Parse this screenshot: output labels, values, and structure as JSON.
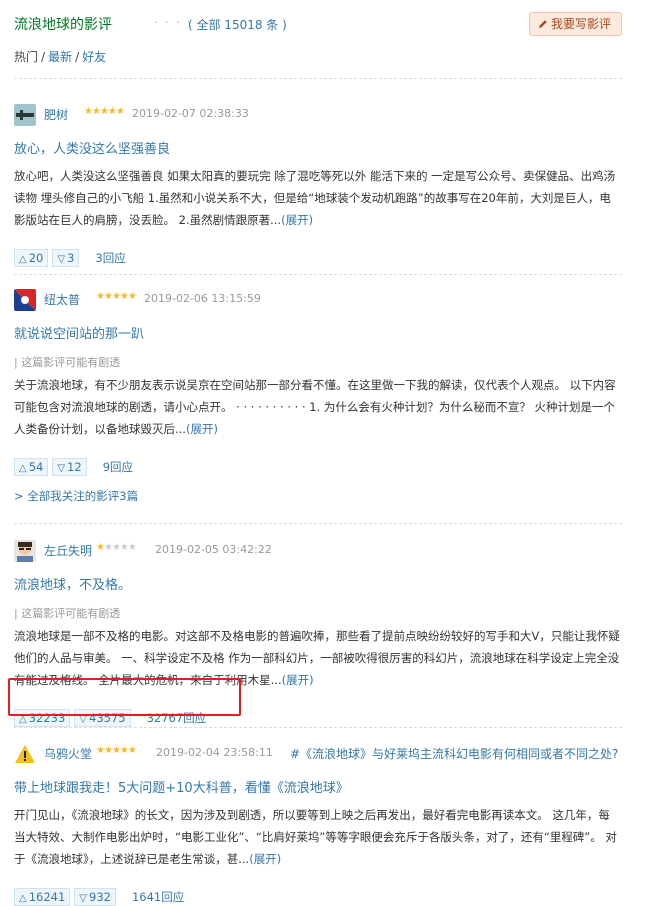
{
  "header": {
    "title": "流浪地球的影评",
    "dots": "· · · · · ·",
    "total": "( 全部 15018 条 )",
    "write_button": "我要写影评"
  },
  "filters": {
    "hot": "热门",
    "sep1": "/",
    "latest": "最新",
    "sep2": "/",
    "friends": "好友"
  },
  "reviews": [
    {
      "author": "肥树",
      "stars": 5,
      "date": "2019-02-07 02:38:33",
      "title": "放心，人类没这么坚强善良",
      "body": "放心吧，人类没这么坚强善良 如果太阳真的要玩完 除了混吃等死以外 能活下来的 一定是写公众号、卖保健品、出鸡汤读物 埋头修自己的小飞船 1.虽然和小说关系不大，但是给“地球装个发动机跑路”的故事写在20年前，大刘是巨人，电影版站在巨人的肩膀，没丢脸。 2.虽然剧情跟原著...",
      "expand": "(展开)",
      "up": "20",
      "down": "3",
      "replies": "3回应"
    },
    {
      "author": "纽太普",
      "stars": 5,
      "date": "2019-02-06 13:15:59",
      "title": "就说说空间站的那一趴",
      "spoiler": "| 这篇影评可能有剧透",
      "body": "关于流浪地球，有不少朋友表示说吴京在空间站那一部分看不懂。在这里做一下我的解读，仅代表个人观点。 以下内容可能包含对流浪地球的剧透，请小心点开。 · · · · · · · · · · 1. 为什么会有火种计划？为什么秘而不宣？ 火种计划是一个人类备份计划，以备地球毁灭后...",
      "expand": "(展开)",
      "up": "54",
      "down": "12",
      "replies": "9回应"
    },
    {
      "author": "左丘失明",
      "stars": 1,
      "date": "2019-02-05 03:42:22",
      "title": "流浪地球，不及格。",
      "spoiler": "| 这篇影评可能有剧透",
      "body": "流浪地球是一部不及格的电影。对这部不及格电影的普遍吹捧，那些看了提前点映纷纷较好的写手和大V，只能让我怀疑他们的人品与审美。 一、科学设定不及格 作为一部科幻片，一部被吹得很厉害的科幻片，流浪地球在科学设定上完全没有能过及格线。 全片最大的危机，来自于利用木星...",
      "expand": "(展开)",
      "up": "32233",
      "down": "43575",
      "replies": "32767回应"
    },
    {
      "author": "乌鸦火堂",
      "stars": 5,
      "date": "2019-02-04 23:58:11",
      "topic": "#《流浪地球》与好莱坞主流科幻电影有何相同或者不同之处?",
      "title": "带上地球跟我走！5大问题+10大科普，看懂《流浪地球》",
      "body": "开门见山，《流浪地球》的长文，因为涉及到剧透，所以要等到上映之后再发出，最好看完电影再读本文。 这几年，每当大特效、大制作电影出炉时，“电影工业化”、“比肩好莱坞”等等字眼便会充斥于各版头条，对了，还有“里程碑”。 对于《流浪地球》，上述说辞已是老生常谈，甚...",
      "expand": "(展开)",
      "up": "16241",
      "down": "932",
      "replies": "1641回应"
    }
  ],
  "more_link": "> 全部我关注的影评3篇",
  "symbols": {
    "up": "△",
    "down": "▽",
    "star_on": "★",
    "star_off": "★"
  },
  "colors": {
    "link": "#3377aa",
    "title_green": "#007722",
    "star": "#f7ba2a",
    "highlight": "#e02020"
  }
}
